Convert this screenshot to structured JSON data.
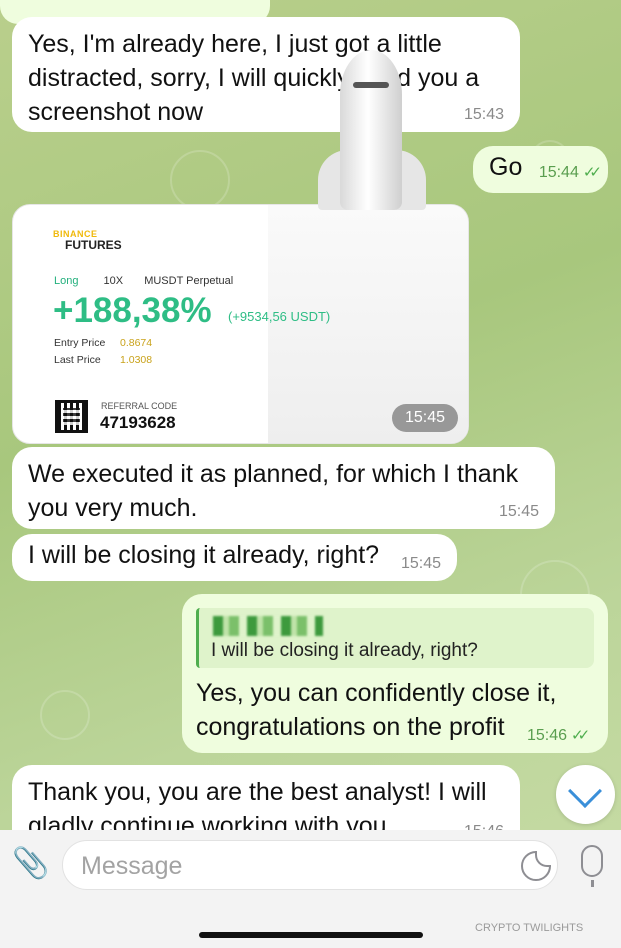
{
  "messages": [
    {
      "id": "m1",
      "text": "Yes, I'm already here, I just got a little distracted, sorry, I will quickly send you a screenshot now",
      "time": "15:43"
    },
    {
      "id": "m2",
      "text": "Go",
      "time": "15:44"
    },
    {
      "id": "m4",
      "text": "We executed it as planned, for which I thank you very much.",
      "time": "15:45"
    },
    {
      "id": "m5",
      "text": "I will be closing it already, right?",
      "time": "15:45"
    },
    {
      "id": "m6",
      "reply_quote": "I will be closing it already, right?",
      "text": "Yes, you can confidently close it, congratulations on the profit",
      "time": "15:46"
    },
    {
      "id": "m7",
      "text": "Thank you, you are the best analyst! I will gladly continue working with you",
      "time": "15:46"
    }
  ],
  "screenshot_card": {
    "brand": "BINANCE",
    "product": "FUTURES",
    "side": "Long",
    "leverage": "10X",
    "pair": "MUSDT Perpetual",
    "pnl_percent": "+188,38%",
    "pnl_usdt": "(+9534,56 USDT)",
    "entry_price_label": "Entry Price",
    "entry_price": "0.8674",
    "last_price_label": "Last Price",
    "last_price": "1.0308",
    "referral_label": "REFERRAL CODE",
    "referral_code": "47193628",
    "time": "15:45"
  },
  "input": {
    "placeholder": "Message"
  },
  "watermark": "CRYPTO TWILIGHTS",
  "icons": {
    "attach": "paperclip-icon",
    "sticker": "sticker-icon",
    "mic": "microphone-icon",
    "scroll": "chevron-down-icon"
  },
  "colors": {
    "outgoing_bubble": "#effdde",
    "incoming_bubble": "#ffffff",
    "check_marks": "#4fae4e",
    "pnl_green": "#2ebd85",
    "scroll_chevron": "#3a8fd9"
  }
}
